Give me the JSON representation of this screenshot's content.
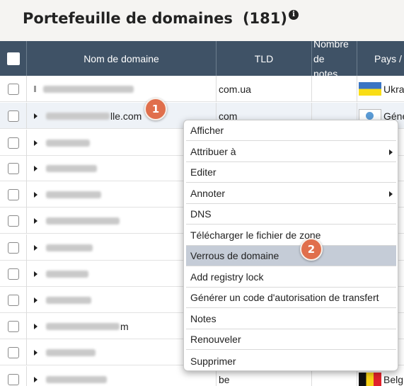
{
  "header": {
    "title": "Portefeuille de domaines",
    "count": "(181)",
    "info_icon": "info-icon"
  },
  "table": {
    "columns": {
      "name": "Nom de domaine",
      "tld": "TLD",
      "notes": "Nombre\nde\nnotes",
      "country": "Pays /"
    },
    "rows": [
      {
        "name": "",
        "tld": "com.ua",
        "country": "Ukra",
        "flag": "ukraine-flag-icon",
        "expandable": false
      },
      {
        "name": "lle.com",
        "tld": "com",
        "country": "Géné",
        "flag": "globe-flag-icon",
        "expandable": true
      },
      {
        "name": "",
        "tld": "",
        "country": "",
        "flag": "",
        "expandable": true
      },
      {
        "name": "",
        "tld": "",
        "country": "",
        "flag": "",
        "expandable": true
      },
      {
        "name": "",
        "tld": "",
        "country": "",
        "flag": "",
        "expandable": true
      },
      {
        "name": "",
        "tld": "",
        "country": "",
        "flag": "",
        "expandable": true
      },
      {
        "name": "",
        "tld": "",
        "country": "",
        "flag": "",
        "expandable": true
      },
      {
        "name": "",
        "tld": "",
        "country": "",
        "flag": "",
        "expandable": true
      },
      {
        "name": "",
        "tld": "",
        "country": "",
        "flag": "",
        "expandable": true
      },
      {
        "name": "m",
        "tld": "",
        "country": "",
        "flag": "",
        "expandable": true
      },
      {
        "name": "",
        "tld": "",
        "country": "",
        "flag": "",
        "expandable": true
      },
      {
        "name": "",
        "tld": "be",
        "country": "Belg",
        "flag": "belgium-flag-icon",
        "expandable": true
      }
    ]
  },
  "context_menu": {
    "items": [
      {
        "label": "Afficher",
        "submenu": false
      },
      {
        "label": "Attribuer à",
        "submenu": true
      },
      {
        "label": "Editer",
        "submenu": false
      },
      {
        "label": "Annoter",
        "submenu": true
      },
      {
        "label": "DNS",
        "submenu": false
      },
      {
        "label": "Télécharger le fichier de zone",
        "submenu": false
      },
      {
        "label": "Verrous de domaine",
        "submenu": false,
        "active": true
      },
      {
        "label": "Add registry lock",
        "submenu": false
      },
      {
        "label": "Générer un code d'autorisation de transfert",
        "submenu": false
      },
      {
        "label": "Notes",
        "submenu": false
      },
      {
        "label": "Renouveler",
        "submenu": false
      },
      {
        "label": "Supprimer",
        "submenu": false
      }
    ]
  },
  "annotations": {
    "step1": "1",
    "step2": "2"
  },
  "colors": {
    "header_bg": "#3f5266",
    "badge": "#e06f4c",
    "menu_active": "#c5ccd7"
  }
}
